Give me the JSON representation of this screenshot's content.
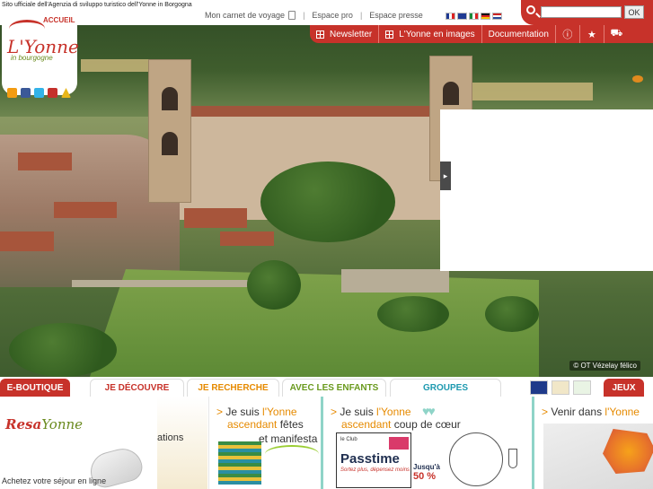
{
  "header": {
    "tagline": "Sito ufficiale dell'Agenzia di sviluppo turistico dell'Yonne in Borgogna",
    "links": [
      {
        "label": "Mon carnet de voyage"
      },
      {
        "label": "Espace pro"
      },
      {
        "label": "Espace presse"
      }
    ],
    "languages": [
      "fr",
      "en",
      "it",
      "de",
      "nl"
    ],
    "search": {
      "placeholder": "",
      "button_label": "OK"
    }
  },
  "nav": {
    "items": [
      {
        "label": "Newsletter",
        "icon": "grid-icon"
      },
      {
        "label": "L'Yonne en images",
        "icon": "grid-icon"
      },
      {
        "label": "Documentation"
      }
    ],
    "icon_buttons": [
      "info-icon",
      "star-icon",
      "car-icon"
    ]
  },
  "logo": {
    "accueil": "ACCUEIL",
    "name": "L'Yonne",
    "sub": "in bourgogne"
  },
  "social": [
    "rss-icon",
    "facebook-icon",
    "twitter-icon",
    "youtube-icon",
    "camping-icon"
  ],
  "hero": {
    "credit": "© OT Vézelay félico",
    "panel_toggle": "▸"
  },
  "tabs": {
    "eshop": "E-BOUTIQUE",
    "decouvre": "JE DÉCOUVRE",
    "recherche": "JE RECHERCHE",
    "enfants": "AVEC LES ENFANTS",
    "groupes": "GROUPES",
    "jeux": "JEUX"
  },
  "panels": {
    "resa": {
      "logo_a": "Resa",
      "logo_b": "Yonne",
      "cta": "Achetez votre séjour en ligne"
    },
    "ticker": {
      "text": "ations"
    },
    "fetes": {
      "line1_prefix": ">",
      "line1_a": "Je suis ",
      "line1_hl": "l'Yonne",
      "line2_hl": "ascendant",
      "line2_b": " fêtes",
      "line3": "et manifesta"
    },
    "coeur": {
      "line1_prefix": ">",
      "line1_a": "Je suis ",
      "line1_hl": "l'Yonne",
      "line2_hl": "ascendant",
      "line2_b": " coup de cœur",
      "pass_top": "le Club",
      "pass_name": "Passtime",
      "pass_sub": "Sortez plus, dépensez moins",
      "promo_a": "Jusqu'à",
      "promo_pct": "50 %"
    },
    "venir": {
      "line1_prefix": ">",
      "line1_a": "Venir dans ",
      "line1_hl": "l'Yonne"
    }
  },
  "colors": {
    "brand_red": "#c7322a",
    "accent_orange": "#e68a00",
    "accent_green": "#6a9a1e",
    "accent_teal": "#1e9ab0"
  }
}
